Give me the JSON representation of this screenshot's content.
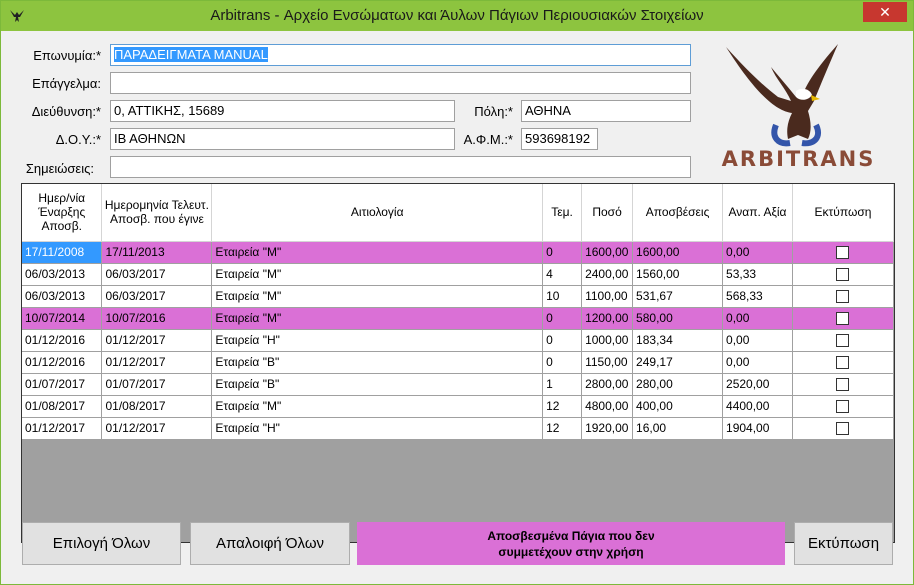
{
  "window": {
    "title": "Arbitrans - Αρχείο Ενσώματων και Άυλων Πάγιων Περιουσιακών Στοιχείων",
    "close_glyph": "✕"
  },
  "form": {
    "name_label": "Επωνυμία:*",
    "name_value": "ΠΑΡΑΔΕΙΓΜΑΤΑ MANUAL",
    "profession_label": "Επάγγελμα:",
    "profession_value": "",
    "address_label": "Διεύθυνση:*",
    "address_value": "0, ΑΤΤΙΚΗΣ, 15689",
    "city_label": "Πόλη:*",
    "city_value": "ΑΘΗΝΑ",
    "tax_office_label": "Δ.Ο.Υ.:*",
    "tax_office_value": "ΙΒ ΑΘΗΝΩΝ",
    "afm_label": "Α.Φ.Μ.:*",
    "afm_value": "593698192",
    "notes_label": "Σημειώσεις:",
    "notes_value": ""
  },
  "logo": {
    "text": "ARBITRANS"
  },
  "table": {
    "headers": [
      "Ημερ/νία Έναρξης Αποσβ.",
      "Ημερομηνία Τελευτ. Αποσβ. που έγινε",
      "Αιτιολογία",
      "Τεμ.",
      "Ποσό",
      "Αποσβέσεις",
      "Αναπ. Αξία",
      "Εκτύπωση"
    ],
    "rows": [
      {
        "start": "17/11/2008",
        "last": "17/11/2013",
        "reason": "Εταιρεία \"Μ\"",
        "qty": "0",
        "amount": "1600,00",
        "depr": "1600,00",
        "residual": "0,00",
        "highlight": true
      },
      {
        "start": "06/03/2013",
        "last": "06/03/2017",
        "reason": "Εταιρεία \"Μ\"",
        "qty": "4",
        "amount": "2400,00",
        "depr": "1560,00",
        "residual": "53,33",
        "highlight": false
      },
      {
        "start": "06/03/2013",
        "last": "06/03/2017",
        "reason": "Εταιρεία \"Μ\"",
        "qty": "10",
        "amount": "1100,00",
        "depr": "531,67",
        "residual": "568,33",
        "highlight": false
      },
      {
        "start": "10/07/2014",
        "last": "10/07/2016",
        "reason": "Εταιρεία \"Μ\"",
        "qty": "0",
        "amount": "1200,00",
        "depr": "580,00",
        "residual": "0,00",
        "highlight": true
      },
      {
        "start": "01/12/2016",
        "last": "01/12/2017",
        "reason": "Εταιρεία \"Η\"",
        "qty": "0",
        "amount": "1000,00",
        "depr": "183,34",
        "residual": "0,00",
        "highlight": false
      },
      {
        "start": "01/12/2016",
        "last": "01/12/2017",
        "reason": "Εταιρεία \"Β\"",
        "qty": "0",
        "amount": "1150,00",
        "depr": "249,17",
        "residual": "0,00",
        "highlight": false
      },
      {
        "start": "01/07/2017",
        "last": "01/07/2017",
        "reason": "Εταιρεία \"Β\"",
        "qty": "1",
        "amount": "2800,00",
        "depr": "280,00",
        "residual": "2520,00",
        "highlight": false
      },
      {
        "start": "01/08/2017",
        "last": "01/08/2017",
        "reason": "Εταιρεία \"Μ\"",
        "qty": "12",
        "amount": "4800,00",
        "depr": "400,00",
        "residual": "4400,00",
        "highlight": false
      },
      {
        "start": "01/12/2017",
        "last": "01/12/2017",
        "reason": "Εταιρεία \"Η\"",
        "qty": "12",
        "amount": "1920,00",
        "depr": "16,00",
        "residual": "1904,00",
        "highlight": false
      }
    ]
  },
  "buttons": {
    "select_all": "Επιλογή Όλων",
    "clear_all": "Απαλοιφή Όλων",
    "legend_line1": "Αποσβεσμένα Πάγια που δεν",
    "legend_line2": "συμμετέχουν στην χρήση",
    "print": "Εκτύπωση"
  },
  "colors": {
    "titlebar": "#8dc43f",
    "highlight": "#da70d6",
    "selection": "#3399ff"
  }
}
